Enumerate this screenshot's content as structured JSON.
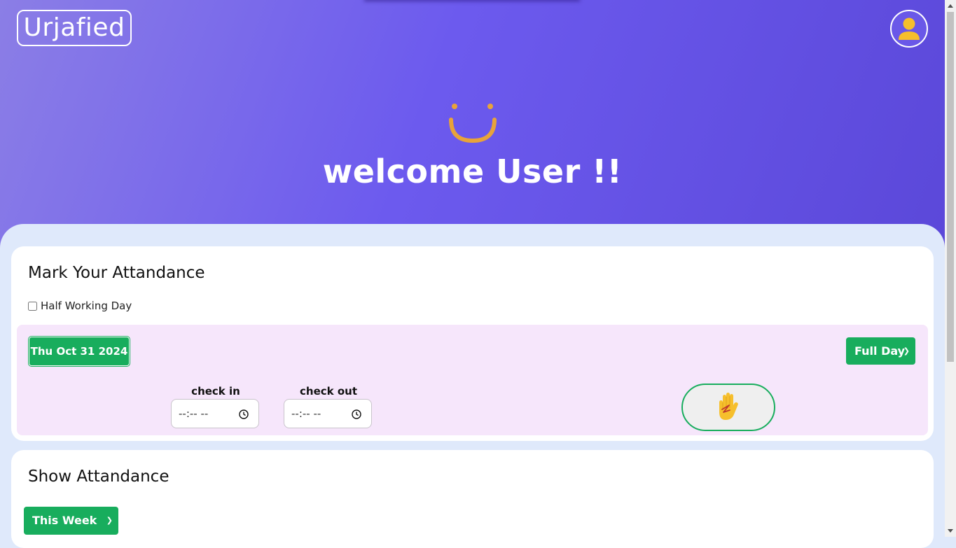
{
  "header": {
    "logo_text": "Urjafied",
    "avatar_icon": "user-avatar-icon",
    "welcome_text": "welcome User !!",
    "smile_icon": "smile-icon"
  },
  "colors": {
    "hero_start": "#8b7ee6",
    "hero_mid": "#6c5aee",
    "hero_end": "#5b48d9",
    "accent_green": "#18ad5d",
    "panel_bg": "#f6e6fb",
    "page_bg": "#dfe9fb",
    "smile": "#e8a33a",
    "avatar_figure": "#f6bf2c"
  },
  "mark_attendance": {
    "title": "Mark Your Attandance",
    "half_day_label": "Half Working Day",
    "half_day_checked": false,
    "date_label": "Thu Oct 31 2024",
    "day_type_selected": "Full Day",
    "check_in_label": "check in",
    "check_in_value": "--:-- --",
    "check_out_label": "check out",
    "check_out_value": "--:-- --",
    "raise_hand_icon": "raised-hand-icon"
  },
  "show_attendance": {
    "title": "Show Attandance",
    "range_selected": "This Week"
  }
}
